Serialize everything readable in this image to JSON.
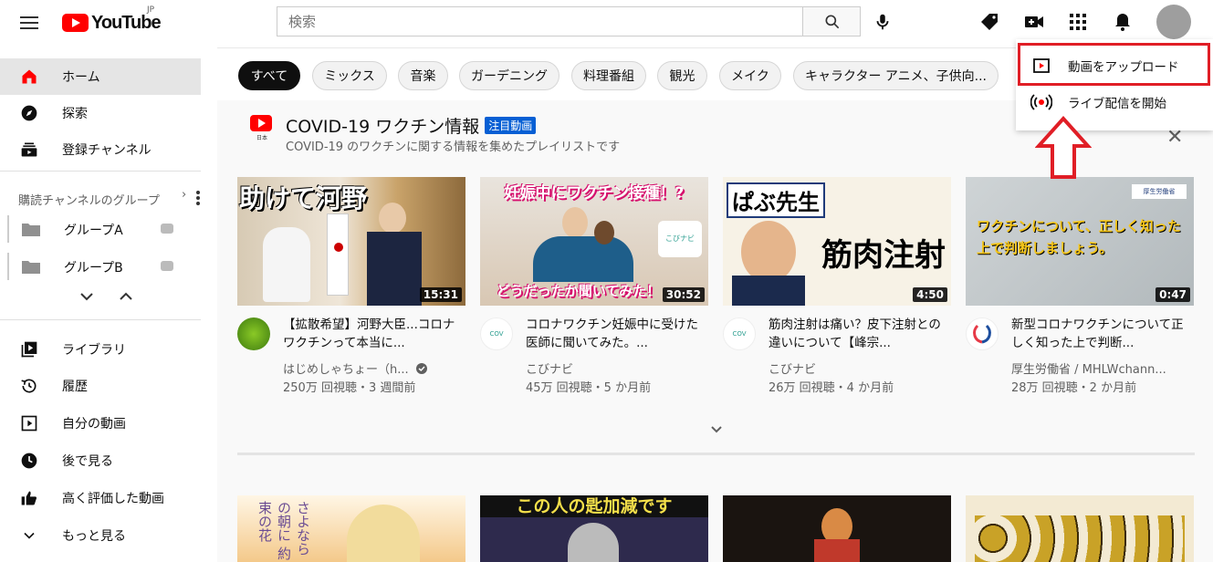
{
  "header": {
    "logo_text": "YouTube",
    "logo_region": "JP",
    "search_placeholder": "検索"
  },
  "sidebar": {
    "items_main": [
      {
        "label": "ホーム",
        "icon": "home-icon"
      },
      {
        "label": "探索",
        "icon": "compass-icon"
      },
      {
        "label": "登録チャンネル",
        "icon": "subscriptions-icon"
      }
    ],
    "group_section_title": "購読チャンネルのグループ",
    "groups": [
      {
        "label": "グループA"
      },
      {
        "label": "グループB"
      }
    ],
    "items_library": [
      {
        "label": "ライブラリ",
        "icon": "library-icon"
      },
      {
        "label": "履歴",
        "icon": "history-icon"
      },
      {
        "label": "自分の動画",
        "icon": "my-videos-icon"
      },
      {
        "label": "後で見る",
        "icon": "watch-later-icon"
      },
      {
        "label": "高く評価した動画",
        "icon": "thumbs-up-icon"
      },
      {
        "label": "もっと見る",
        "icon": "chevron-down-icon"
      }
    ]
  },
  "chips": [
    "すべて",
    "ミックス",
    "音楽",
    "ガーデニング",
    "料理番組",
    "観光",
    "メイク",
    "キャラクター アニメ、子供向..."
  ],
  "shelf": {
    "title": "COVID-19 ワクチン情報",
    "badge": "注目動画",
    "subtitle": "COVID-19 のワクチンに関する情報を集めたプレイリストです",
    "close": "✕",
    "logo_caption": "日本"
  },
  "videos": [
    {
      "title": "【拡散希望】河野大臣...コロナワクチンって本当に...",
      "channel": "はじめしゃちょー（h...",
      "meta": "250万 回視聴・3 週間前",
      "duration": "15:31",
      "thumb_text": "助けて河野",
      "verified": true
    },
    {
      "title": "コロナワクチン妊娠中に受けた医師に聞いてみた。...",
      "channel": "こびナビ",
      "meta": "45万 回視聴・5 か月前",
      "duration": "30:52",
      "thumb_text": "妊娠中にワクチン接種！?",
      "thumb_text2": "どうだったか聞いてみた！",
      "verified": false
    },
    {
      "title": "筋肉注射は痛い？皮下注射との違いについて【峰宗...",
      "channel": "こびナビ",
      "meta": "26万 回視聴・4 か月前",
      "duration": "4:50",
      "thumb_text": "ぱぶ先生",
      "thumb_text2": "筋肉注射",
      "verified": false
    },
    {
      "title": "新型コロナワクチンについて正しく知った上で判断...",
      "channel": "厚生労働省 / MHLWchann...",
      "meta": "28万 回視聴・2 か月前",
      "duration": "0:47",
      "thumb_text": "ワクチンについて、正しく知った上で判断しましょう。",
      "verified": false
    }
  ],
  "row2_thumb_text": "この人の匙加減です",
  "dropdown": {
    "items": [
      {
        "label": "動画をアップロード",
        "icon": "upload-video-icon"
      },
      {
        "label": "ライブ配信を開始",
        "icon": "go-live-icon"
      }
    ]
  },
  "colors": {
    "accent_red": "#ff0000",
    "highlight_red": "#e01e26",
    "badge_blue": "#065fd4"
  }
}
